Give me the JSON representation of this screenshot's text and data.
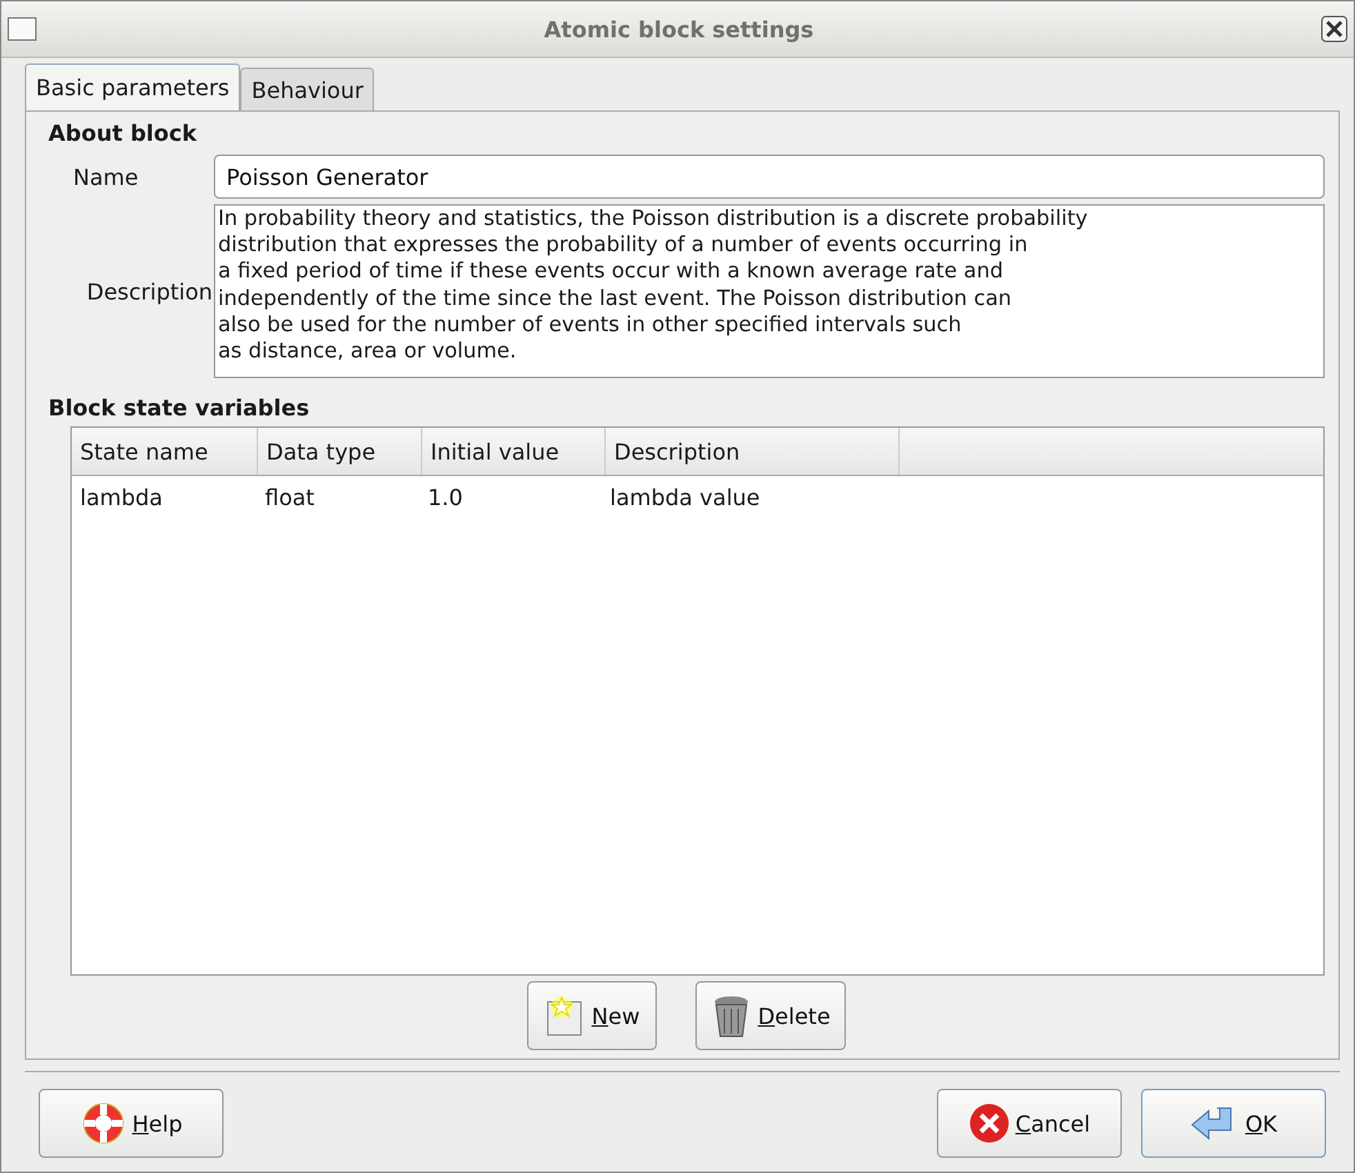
{
  "window": {
    "title": "Atomic block settings"
  },
  "tabs": [
    {
      "label": "Basic parameters",
      "selected": true
    },
    {
      "label": "Behaviour",
      "selected": false
    }
  ],
  "about": {
    "heading": "About block",
    "name_label": "Name",
    "name_value": "Poisson Generator",
    "description_label": "Description",
    "description_lines": [
      "In probability theory and statistics, the Poisson distribution is a discrete probability",
      "distribution that expresses the probability of a number of events occurring in",
      "a fixed period of time if these events occur with a known average rate and",
      "independently of the time since the last event. The Poisson distribution can",
      "also be used for the number of events in other specified intervals such",
      "as distance, area or volume."
    ]
  },
  "variables": {
    "heading": "Block state variables",
    "columns": [
      "State name",
      "Data type",
      "Initial value",
      "Description"
    ],
    "rows": [
      [
        "lambda",
        "float",
        "1.0",
        "lambda value"
      ]
    ]
  },
  "table_buttons": [
    {
      "kind": "new",
      "mnemonic": "N",
      "rest": "ew"
    },
    {
      "kind": "delete",
      "mnemonic": "D",
      "rest": "elete"
    }
  ],
  "footer_buttons": [
    {
      "kind": "help",
      "mnemonic": "H",
      "rest": "elp",
      "default": false
    },
    {
      "kind": "cancel",
      "mnemonic": "C",
      "rest": "ancel",
      "default": false
    },
    {
      "kind": "ok",
      "mnemonic": "O",
      "rest": "K",
      "default": true
    }
  ]
}
